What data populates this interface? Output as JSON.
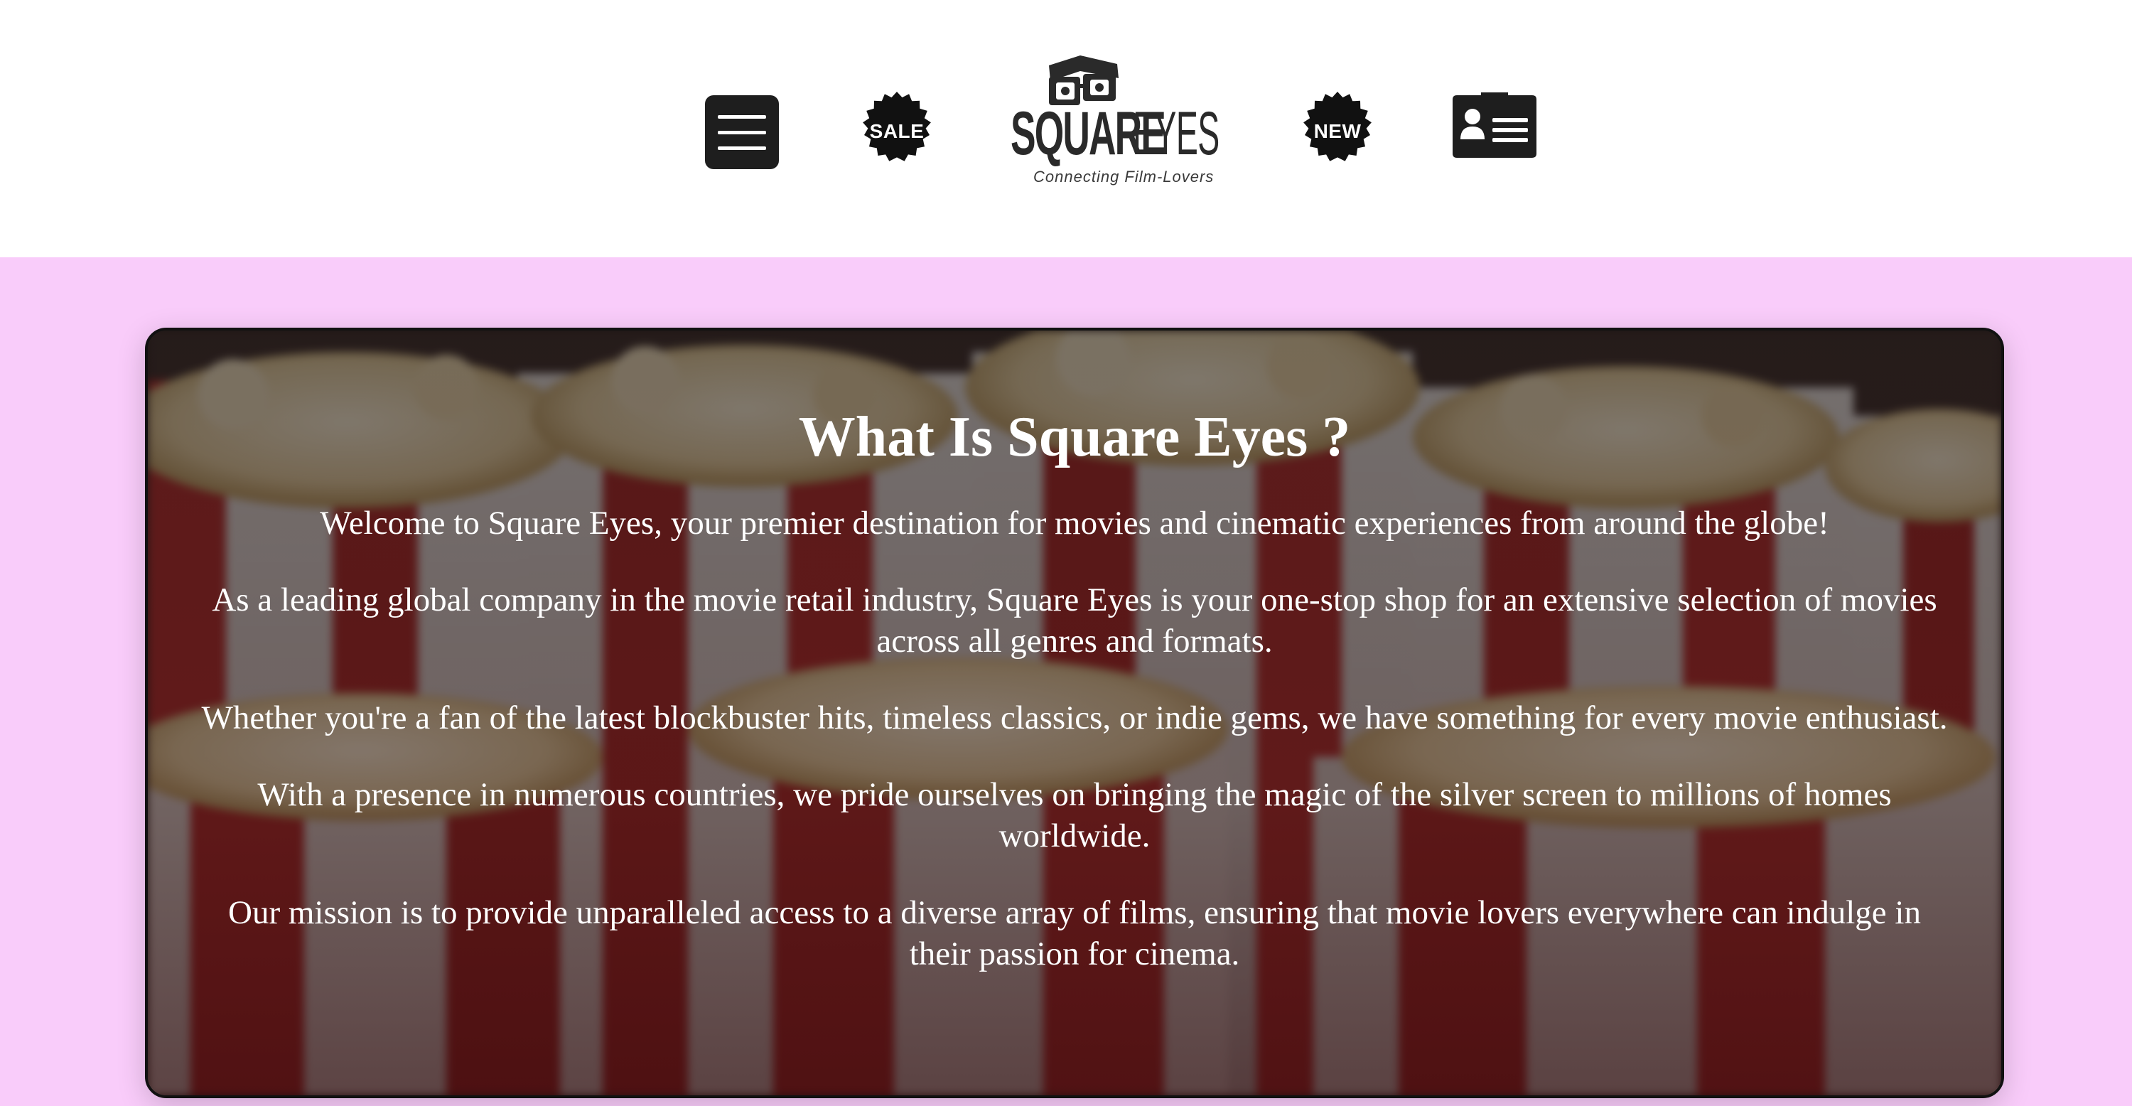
{
  "header": {
    "menu_icon": "hamburger-menu-icon",
    "sale_badge": {
      "label": "SALE",
      "icon": "badge-icon"
    },
    "logo": {
      "word_square": "SQUARE",
      "word_eyes": "EYES",
      "tagline": "Connecting Film-Lovers",
      "icon": "3d-glasses-icon"
    },
    "new_badge": {
      "label": "NEW",
      "icon": "badge-icon"
    },
    "profile_icon": "contact-card-icon"
  },
  "hero": {
    "title": "What Is Square Eyes ?",
    "paragraphs": [
      "Welcome to Square Eyes, your premier destination for movies and cinematic experiences from around the globe!",
      "As a leading global company in the movie retail industry, Square Eyes is your one-stop shop for an extensive selection of movies across all genres and formats.",
      "Whether you're a fan of the latest blockbuster hits, timeless classics, or indie gems, we have something for every movie enthusiast.",
      "With a presence in numerous countries, we pride ourselves on bringing the magic of the silver screen to millions of homes worldwide.",
      "Our mission is to provide unparalleled access to a diverse array of films, ensuring that movie lovers everywhere can indulge in their passion for cinema."
    ],
    "background": "popcorn-background-image"
  },
  "colors": {
    "page_background": "#f9ccfa",
    "header_background": "#ffffff",
    "icon_dark": "#1e1e1e",
    "hero_text": "#ffffff"
  }
}
